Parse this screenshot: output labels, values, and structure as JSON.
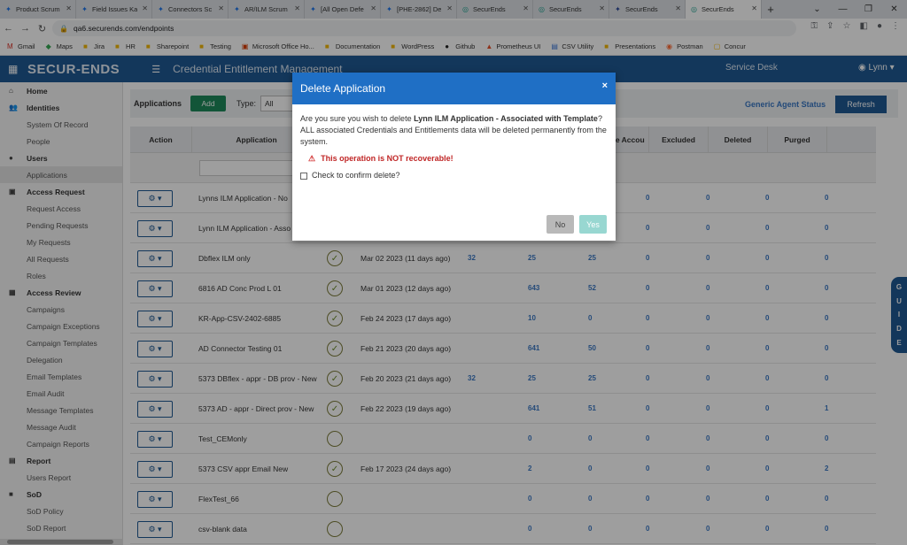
{
  "browser": {
    "tabs": [
      {
        "title": "Product Scrum",
        "icon": "jira-icon",
        "active": false
      },
      {
        "title": "Field Issues Ka",
        "icon": "jira-icon",
        "active": false
      },
      {
        "title": "Connectors Sc",
        "icon": "jira-icon",
        "active": false
      },
      {
        "title": "AR/ILM Scrum",
        "icon": "jira-icon",
        "active": false
      },
      {
        "title": "[All Open Defe",
        "icon": "jira-icon",
        "active": false
      },
      {
        "title": "[PHE-2862] De",
        "icon": "jira-icon",
        "active": false
      },
      {
        "title": "SecurEnds",
        "icon": "securends-icon",
        "active": false
      },
      {
        "title": "SecurEnds",
        "icon": "securends-icon",
        "active": false
      },
      {
        "title": "SecurEnds",
        "icon": "securends-doc-icon",
        "active": false
      },
      {
        "title": "SecurEnds",
        "icon": "securends-icon",
        "active": true
      }
    ],
    "new_tab": "+",
    "url": "qa6.securends.com/endpoints",
    "bookmarks": [
      {
        "label": "Gmail",
        "icon": "gmail-icon"
      },
      {
        "label": "Maps",
        "icon": "maps-icon"
      },
      {
        "label": "Jira",
        "icon": "folder-icon"
      },
      {
        "label": "HR",
        "icon": "folder-icon"
      },
      {
        "label": "Sharepoint",
        "icon": "folder-icon"
      },
      {
        "label": "Testing",
        "icon": "folder-icon"
      },
      {
        "label": "Microsoft Office Ho...",
        "icon": "office-icon"
      },
      {
        "label": "Documentation",
        "icon": "folder-icon"
      },
      {
        "label": "WordPress",
        "icon": "folder-icon"
      },
      {
        "label": "Github",
        "icon": "github-icon"
      },
      {
        "label": "Prometheus UI",
        "icon": "prometheus-icon"
      },
      {
        "label": "CSV Utility",
        "icon": "file-icon"
      },
      {
        "label": "Presentations",
        "icon": "folder-icon"
      },
      {
        "label": "Postman",
        "icon": "postman-icon"
      },
      {
        "label": "Concur",
        "icon": "concur-icon"
      }
    ]
  },
  "header": {
    "logo": "SECUR-ENDS",
    "title": "Credential Entitlement Management",
    "service_desk": "Service Desk",
    "user": "Lynn"
  },
  "sidebar": {
    "sections": [
      {
        "label": "Home",
        "icon": "home-icon",
        "items": []
      },
      {
        "label": "Identities",
        "icon": "users-icon",
        "items": [
          {
            "label": "System Of Record",
            "active": false
          },
          {
            "label": "People",
            "active": false
          }
        ]
      },
      {
        "label": "Users",
        "icon": "user-icon",
        "items": [
          {
            "label": "Applications",
            "active": true
          }
        ]
      },
      {
        "label": "Access Request",
        "icon": "lock-icon",
        "items": [
          {
            "label": "Request Access",
            "active": false
          },
          {
            "label": "Pending Requests",
            "active": false
          },
          {
            "label": "My Requests",
            "active": false
          },
          {
            "label": "All Requests",
            "active": false
          },
          {
            "label": "Roles",
            "active": false
          }
        ]
      },
      {
        "label": "Access Review",
        "icon": "grid-icon",
        "items": [
          {
            "label": "Campaigns",
            "active": false
          },
          {
            "label": "Campaign Exceptions",
            "active": false
          },
          {
            "label": "Campaign Templates",
            "active": false
          },
          {
            "label": "Delegation",
            "active": false
          },
          {
            "label": "Email Templates",
            "active": false
          },
          {
            "label": "Email Audit",
            "active": false
          },
          {
            "label": "Message Templates",
            "active": false
          },
          {
            "label": "Message Audit",
            "active": false
          },
          {
            "label": "Campaign Reports",
            "active": false
          }
        ]
      },
      {
        "label": "Report",
        "icon": "report-icon",
        "items": [
          {
            "label": "Users Report",
            "active": false
          }
        ]
      },
      {
        "label": "SoD",
        "icon": "sod-icon",
        "items": [
          {
            "label": "SoD Policy",
            "active": false
          },
          {
            "label": "SoD Report",
            "active": false
          }
        ]
      }
    ]
  },
  "toolbar": {
    "label": "Applications",
    "add": "Add",
    "type_label": "Type:",
    "type_value": "All",
    "generic_agent_status": "Generic Agent Status",
    "refresh": "Refresh"
  },
  "table": {
    "columns": [
      {
        "label": "Action"
      },
      {
        "label": "Application"
      },
      {
        "label": ""
      },
      {
        "label": ""
      },
      {
        "label": ""
      },
      {
        "label": ""
      },
      {
        "label": "ched"
      },
      {
        "label": "Service Accou"
      },
      {
        "label": "Excluded"
      },
      {
        "label": "Deleted"
      },
      {
        "label": "Purged"
      }
    ],
    "rows": [
      {
        "name": "Lynns ILM Application - No",
        "status": false,
        "date": "",
        "c1": "",
        "c2": "",
        "c3": "",
        "sa": "0",
        "ex": "0",
        "de": "0",
        "pu": "0"
      },
      {
        "name": "Lynn ILM Application - Asso",
        "status": false,
        "date": "",
        "c1": "",
        "c2": "",
        "c3": "",
        "sa": "0",
        "ex": "0",
        "de": "0",
        "pu": "0"
      },
      {
        "name": "Dbflex ILM only",
        "status": true,
        "date": "Mar 02 2023 (11 days ago)",
        "c1": "32",
        "c2": "25",
        "c3": "25",
        "sa": "0",
        "ex": "0",
        "de": "0",
        "pu": "0"
      },
      {
        "name": "6816 AD Conc Prod L 01",
        "status": true,
        "date": "Mar 01 2023 (12 days ago)",
        "c1": "",
        "c2": "643",
        "c3": "52",
        "sa": "0",
        "ex": "0",
        "de": "0",
        "pu": "0"
      },
      {
        "name": "KR-App-CSV-2402-6885",
        "status": true,
        "date": "Feb 24 2023 (17 days ago)",
        "c1": "",
        "c2": "10",
        "c3": "0",
        "sa": "0",
        "ex": "0",
        "de": "0",
        "pu": "0"
      },
      {
        "name": "AD Connector Testing 01",
        "status": true,
        "date": "Feb 21 2023 (20 days ago)",
        "c1": "",
        "c2": "641",
        "c3": "50",
        "sa": "0",
        "ex": "0",
        "de": "0",
        "pu": "0"
      },
      {
        "name": "5373 DBflex - appr - DB prov - New",
        "status": true,
        "date": "Feb 20 2023 (21 days ago)",
        "c1": "32",
        "c2": "25",
        "c3": "25",
        "sa": "0",
        "ex": "0",
        "de": "0",
        "pu": "0"
      },
      {
        "name": "5373 AD - appr - Direct prov - New",
        "status": true,
        "date": "Feb 22 2023 (19 days ago)",
        "c1": "",
        "c2": "641",
        "c3": "51",
        "sa": "0",
        "ex": "0",
        "de": "0",
        "pu": "1"
      },
      {
        "name": "Test_CEMonly",
        "status": false,
        "date": "",
        "c1": "",
        "c2": "0",
        "c3": "0",
        "sa": "0",
        "ex": "0",
        "de": "0",
        "pu": "0"
      },
      {
        "name": "5373 CSV appr Email New",
        "status": true,
        "date": "Feb 17 2023 (24 days ago)",
        "c1": "",
        "c2": "2",
        "c3": "0",
        "sa": "0",
        "ex": "0",
        "de": "0",
        "pu": "2"
      },
      {
        "name": "FlexTest_66",
        "status": false,
        "date": "",
        "c1": "",
        "c2": "0",
        "c3": "0",
        "sa": "0",
        "ex": "0",
        "de": "0",
        "pu": "0"
      },
      {
        "name": "csv-blank data",
        "status": false,
        "date": "",
        "c1": "",
        "c2": "0",
        "c3": "0",
        "sa": "0",
        "ex": "0",
        "de": "0",
        "pu": "0"
      }
    ]
  },
  "guide": "GUIDE",
  "modal": {
    "title": "Delete Application",
    "close": "×",
    "q_prefix": "Are you sure you wish to delete ",
    "q_app": "Lynn ILM Application - Associated with Template",
    "q_suffix": "?",
    "info": "ALL associated Credentials and Entitlements data will be deleted permanently from the system.",
    "warning": "This operation is NOT recoverable!",
    "checkbox_label": "Check to confirm delete?",
    "no": "No",
    "yes": "Yes"
  },
  "colors": {
    "header_bg": "#1f5a94",
    "modal_header": "#1f6fc5",
    "add_button": "#1e8a5b",
    "link_blue": "#3a78c4",
    "warning_red": "#c02626"
  }
}
